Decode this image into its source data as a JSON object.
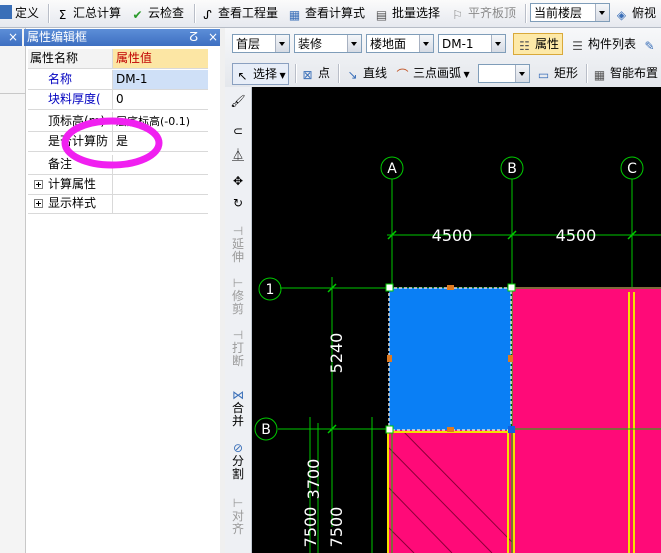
{
  "toolbar1": {
    "define": "定义",
    "sum_calc": "汇总计算",
    "cloud_check": "云检查",
    "view_quantity": "查看工程量",
    "view_formula": "查看计算式",
    "batch_select": "批量选择",
    "flat_board": "平齐板顶",
    "current_floor": "当前楼层",
    "top_view": "俯视"
  },
  "toolbar2": {
    "floor": "首层",
    "category": "装修",
    "component_type": "楼地面",
    "component": "DM-1",
    "properties": "属性",
    "component_list": "构件列表"
  },
  "toolbar3": {
    "select": "选择",
    "point": "点",
    "line": "直线",
    "arc3": "三点画弧",
    "rect": "矩形",
    "smart_layout": "智能布置"
  },
  "panel": {
    "title": "属性编辑框",
    "pin": "ⵒ",
    "close": "×",
    "col_name": "属性名称",
    "col_value": "属性值",
    "rows": [
      {
        "name": "名称",
        "value": "DM-1"
      },
      {
        "name": "块料厚度(",
        "value": "0"
      },
      {
        "name": "顶标高(m)",
        "value": "层底标高(-0.1)"
      },
      {
        "name": "是否计算防",
        "value": "是"
      },
      {
        "name": "备注",
        "value": ""
      },
      {
        "name": "计算属性",
        "value": ""
      },
      {
        "name": "显示样式",
        "value": ""
      }
    ]
  },
  "tools": [
    "延伸",
    "修剪",
    "打断",
    "合并",
    "分割",
    "对齐"
  ],
  "drawing": {
    "axes_x": [
      "A",
      "B",
      "C"
    ],
    "axes_y": [
      "1",
      "B"
    ],
    "dim_top": [
      "4500",
      "4500"
    ],
    "dim_left": [
      "5240",
      "3700",
      "7500",
      "7500"
    ]
  },
  "colors": {
    "selected_fill": "#0a7ff5",
    "slab_fill": "#ff0a78",
    "axis_green": "#00c800",
    "highlight_ellipse": "#f020f0"
  }
}
